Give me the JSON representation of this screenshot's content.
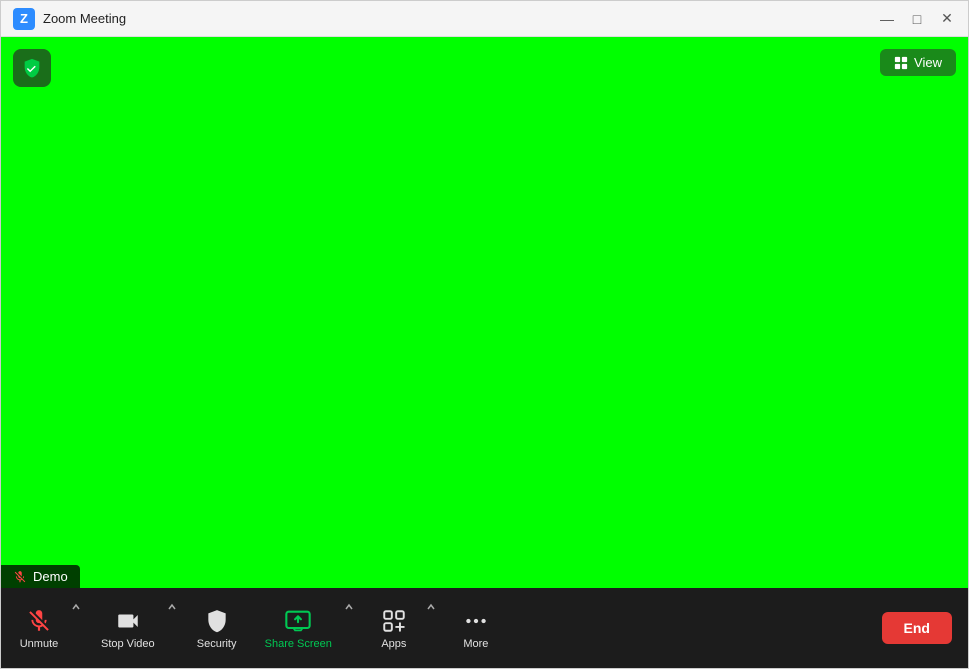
{
  "window": {
    "title": "Zoom Meeting",
    "logo_letter": "Z"
  },
  "controls": {
    "minimize": "—",
    "maximize": "□",
    "close": "✕"
  },
  "main_area": {
    "background_color": "#00ff00",
    "shield_badge_color": "#1a6e1a"
  },
  "view_button": {
    "label": "View"
  },
  "demo_label": {
    "text": "Demo"
  },
  "toolbar": {
    "items": [
      {
        "id": "unmute",
        "label": "Unmute",
        "has_chevron": true,
        "active": false,
        "color": "default"
      },
      {
        "id": "stop-video",
        "label": "Stop Video",
        "has_chevron": true,
        "active": false,
        "color": "default"
      },
      {
        "id": "security",
        "label": "Security",
        "has_chevron": false,
        "active": false,
        "color": "default"
      },
      {
        "id": "share-screen",
        "label": "Share Screen",
        "has_chevron": true,
        "active": true,
        "color": "green"
      },
      {
        "id": "apps",
        "label": "Apps",
        "has_chevron": true,
        "active": false,
        "color": "default"
      },
      {
        "id": "more",
        "label": "More",
        "has_chevron": false,
        "active": false,
        "color": "default"
      }
    ],
    "end_button_label": "End"
  }
}
